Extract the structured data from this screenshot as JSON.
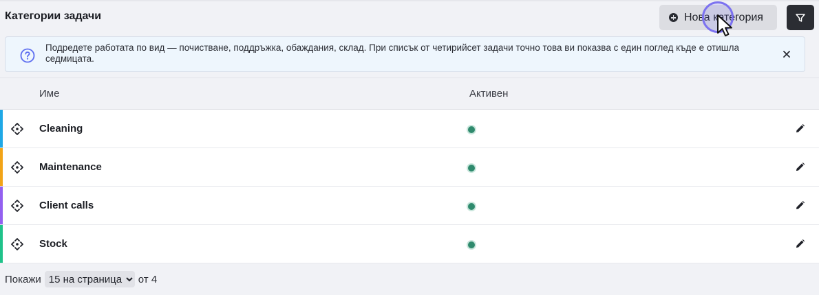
{
  "header": {
    "title": "Категории задачи",
    "new_button_label": "Нова категория",
    "new_button_icon": "plus-circle-icon",
    "filter_icon": "filter-icon"
  },
  "info_banner": {
    "icon": "question-circle-icon",
    "text": "Подредете работата по вид — почистване, поддръжка, обаждания, склад. При списък от четирийсет задачи точно това ви показва с един поглед къде е отишла седмицата.",
    "close_icon": "close-icon"
  },
  "table": {
    "columns": [
      "Име",
      "Активен"
    ],
    "rows": [
      {
        "name": "Cleaning",
        "active": true,
        "color": "#1fa8e6"
      },
      {
        "name": "Maintenance",
        "active": true,
        "color": "#f2a417"
      },
      {
        "name": "Client calls",
        "active": true,
        "color": "#9360f0"
      },
      {
        "name": "Stock",
        "active": true,
        "color": "#1fc28a"
      }
    ],
    "row_icons": {
      "drag": "move-arrows-icon",
      "edit": "pencil-icon"
    }
  },
  "footer": {
    "show_label": "Покажи",
    "page_size_selected": "15 на страница",
    "total_label": "от 4"
  },
  "colors": {
    "accent_cursor": "#7c72f0",
    "active_dot": "#2f8a6d"
  }
}
